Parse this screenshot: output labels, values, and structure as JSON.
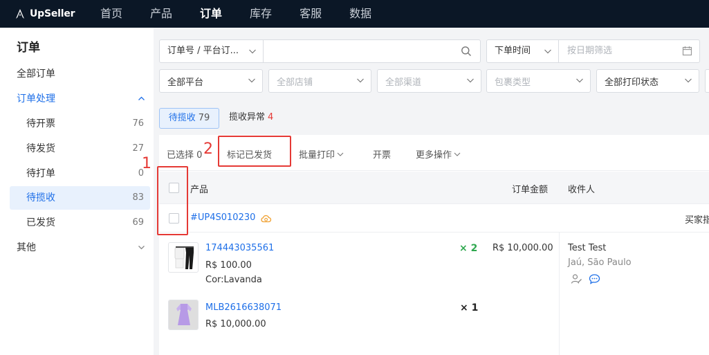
{
  "brand": {
    "name": "UpSeller"
  },
  "nav": [
    "首页",
    "产品",
    "订单",
    "库存",
    "客服",
    "数据"
  ],
  "nav_active_index": 2,
  "sidebar": {
    "title": "订单",
    "all_orders": "全部订单",
    "group_label": "订单处理",
    "items": [
      {
        "label": "待开票",
        "count": "76"
      },
      {
        "label": "待发货",
        "count": "27"
      },
      {
        "label": "待打单",
        "count": "0"
      },
      {
        "label": "待揽收",
        "count": "83"
      },
      {
        "label": "已发货",
        "count": "69"
      }
    ],
    "other": "其他"
  },
  "filters": {
    "search_field": "订单号 / 平台订...",
    "time_field": "下单时间",
    "date_placeholder": "按日期筛选",
    "platform": "全部平台",
    "shop": "全部店铺",
    "channel": "全部渠道",
    "package_type": "包裹类型",
    "print_status": "全部打印状态"
  },
  "status_tabs": {
    "active_label": "待揽收",
    "active_count": "79",
    "other_label": "揽收异常",
    "other_count": "4"
  },
  "action_bar": {
    "selected_label": "已选择",
    "selected_count": "0",
    "mark_shipped": "标记已发货",
    "batch_print": "批量打印",
    "invoice": "开票",
    "more": "更多操作"
  },
  "table": {
    "headers": {
      "product": "产品",
      "amount": "订单金额",
      "recipient": "收件人"
    },
    "order": {
      "id": "#UP4S010230",
      "buyer_note": "买家指",
      "products": [
        {
          "sku": "174443035561",
          "price": "R$ 100.00",
          "variant": "Cor:Lavanda",
          "qty": "× 2"
        },
        {
          "sku": "MLB2616638071",
          "price": "R$ 10,000.00",
          "variant": "",
          "qty": "× 1"
        }
      ],
      "total": "R$ 10,000.00",
      "recipient_name": "Test Test",
      "recipient_location": "Jaú, São Paulo"
    }
  },
  "annotations": {
    "label1": "1",
    "label2": "2"
  },
  "colors": {
    "brand_blue": "#1e6fe8",
    "topbar": "#0b1726",
    "annotation_red": "#e53935",
    "qty_green": "#2fa84f"
  }
}
